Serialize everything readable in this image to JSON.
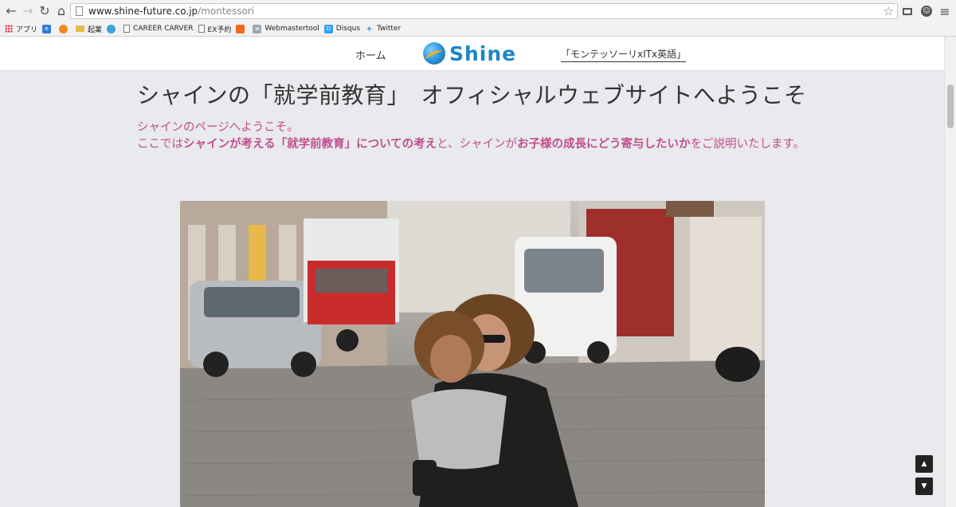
{
  "browser": {
    "url_host": "www.shine-future.co.jp",
    "url_path": "/montessori",
    "bookmarks": [
      {
        "label": "アプリ",
        "icon": "apps-icon"
      },
      {
        "label": "",
        "icon": "bookmark-blue-icon"
      },
      {
        "label": "",
        "icon": "bookmark-orange-icon"
      },
      {
        "label": "起業",
        "icon": "folder-icon"
      },
      {
        "label": "",
        "icon": "bookmark-globe-icon"
      },
      {
        "label": "CAREER CARVER",
        "icon": "page-icon"
      },
      {
        "label": "EX予約",
        "icon": "page-icon"
      },
      {
        "label": "",
        "icon": "bookmark-orange-square-icon"
      },
      {
        "label": "Webmastertool",
        "icon": "webmaster-icon"
      },
      {
        "label": "Disqus",
        "icon": "disqus-icon"
      },
      {
        "label": "Twitter",
        "icon": "twitter-icon"
      }
    ]
  },
  "site": {
    "nav_home": "ホーム",
    "logo_text": "Shine",
    "nav_montessori": "「モンテッソーリxITx英語」"
  },
  "content": {
    "heading": "シャインの「就学前教育」　オフィシャルウェブサイトへようこそ",
    "intro_line1": "シャインのページへようこそ。",
    "intro_p1": "ここでは",
    "intro_b1": "シャインが考える「就学前教育」についての考え",
    "intro_p2": "と、シャインが",
    "intro_b2": "お子様の成長にどう寄与したいか",
    "intro_p3": "をご説明いたします。"
  },
  "colors": {
    "accent_pink": "#c14e8e",
    "logo_blue": "#1a86c8",
    "logo_orange": "#ffb400"
  }
}
